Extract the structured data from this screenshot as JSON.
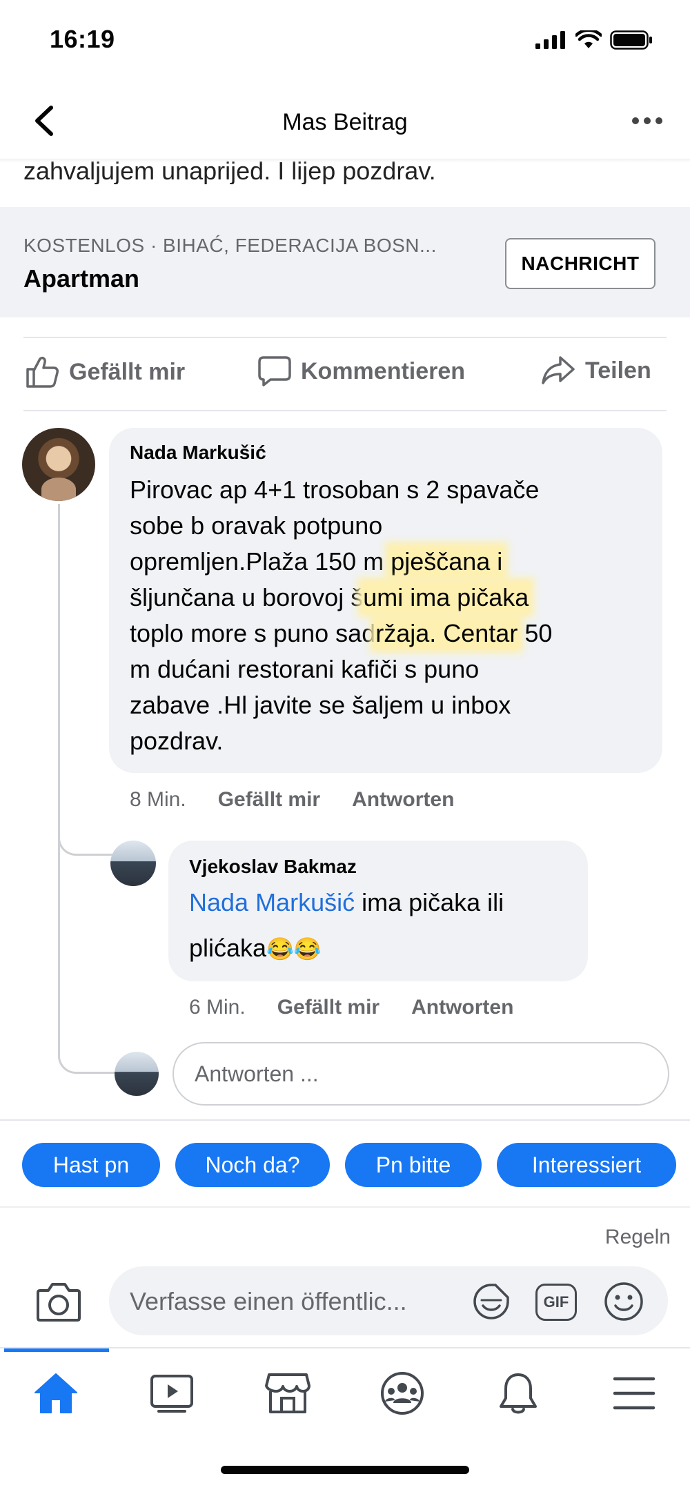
{
  "status_bar": {
    "time": "16:19"
  },
  "nav": {
    "title": "Mas Beitrag"
  },
  "post": {
    "text_tail": "zahvaljujem unaprijed. I lijep pozdrav."
  },
  "listing": {
    "meta": "KOSTENLOS · BIHAĆ, FEDERACIJA BOSN...",
    "title": "Apartman",
    "message_button": "NACHRICHT"
  },
  "actions": {
    "like": "Gefällt mir",
    "comment": "Kommentieren",
    "share": "Teilen"
  },
  "comments": [
    {
      "author": "Nada Markušić",
      "lines": [
        "Pirovac ap 4+1 trosoban s 2 spavače",
        "sobe b oravak potpuno",
        "opremljen.Plaža 150 m ",
        "pješčana i",
        "šljunčana u borovoj š",
        "umi ima pičaka",
        "toplo more s puno sad",
        "ržaja. Centar",
        " 50",
        "m dućani restorani kafiči s puno",
        "zabave .Hl javite se šaljem u inbox",
        "pozdrav."
      ],
      "time": "8 Min.",
      "like": "Gefällt mir",
      "reply": "Antworten"
    },
    {
      "author": "Vjekoslav Bakmaz",
      "mention": "Nada Markušić",
      "text_line1": " ima pičaka ili",
      "text_line2": "plićaka",
      "emoji": "😂😂",
      "time": "6 Min.",
      "like": "Gefällt mir",
      "reply": "Antworten"
    }
  ],
  "reply_input": {
    "placeholder": "Antworten ..."
  },
  "quick_replies": [
    "Hast pn",
    "Noch da?",
    "Pn bitte",
    "Interessiert"
  ],
  "rules_link": "Regeln",
  "composer": {
    "placeholder": "Verfasse einen öffentlic...",
    "gif": "GIF"
  },
  "colors": {
    "accent": "#1877f2",
    "muted": "#65676b",
    "bubble": "#f0f2f5",
    "highlight": "#fdf0b0"
  },
  "icons": [
    "back-chevron-icon",
    "more-icon",
    "thumbs-up-icon",
    "comment-icon",
    "share-icon",
    "camera-icon",
    "sticker-icon",
    "gif-icon",
    "emoji-icon",
    "home-icon",
    "video-icon",
    "marketplace-icon",
    "groups-icon",
    "bell-icon",
    "menu-icon"
  ]
}
